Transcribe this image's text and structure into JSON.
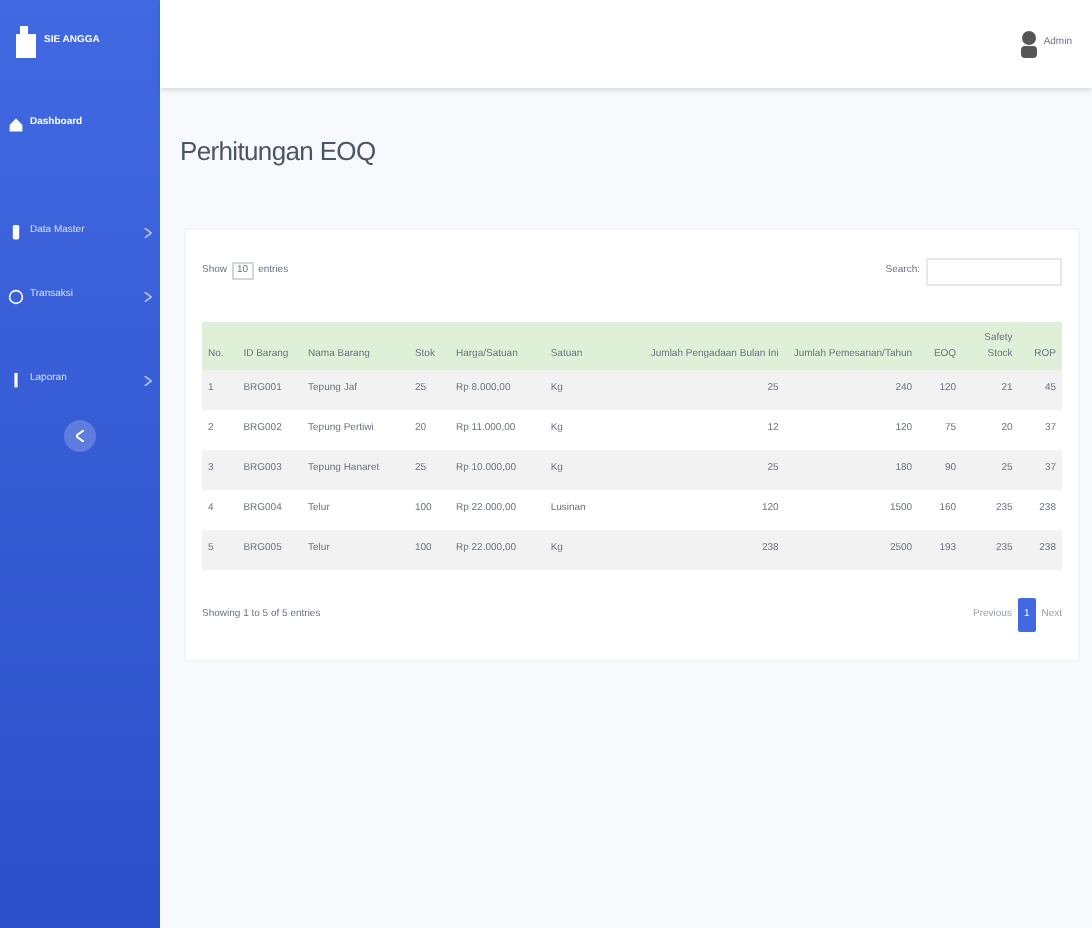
{
  "brand": "SIE ANGGA",
  "sidebar": {
    "items": [
      {
        "label": "Dashboard",
        "selected": true,
        "expandable": false
      },
      {
        "label": "Data Master",
        "selected": false,
        "expandable": true
      },
      {
        "label": "Transaksi",
        "selected": false,
        "expandable": true
      },
      {
        "label": "Laporan",
        "selected": false,
        "expandable": true
      }
    ]
  },
  "topbar": {
    "user": "Admin"
  },
  "page_title": "Perhitungan EOQ",
  "table_controls": {
    "show": "Show",
    "entries_value": "10",
    "entries": "entries",
    "search_label": "Search:"
  },
  "table": {
    "columns": [
      "No.",
      "ID Barang",
      "Nama Barang",
      "Stok",
      "Harga/Satuan",
      "Satuan",
      "Jumlah Pengadaan Bulan Ini",
      "Jumlah Pemesanan/Tahun",
      "EOQ",
      "Safety Stock",
      "ROP"
    ],
    "rows": [
      [
        "1",
        "BRG001",
        "Tepung Jaf",
        "25",
        "Rp 8.000,00",
        "Kg",
        "25",
        "240",
        "120",
        "21",
        "45"
      ],
      [
        "2",
        "BRG002",
        "Tepung Pertiwi",
        "20",
        "Rp 11.000,00",
        "Kg",
        "12",
        "120",
        "75",
        "20",
        "37"
      ],
      [
        "3",
        "BRG003",
        "Tepung Hanaret",
        "25",
        "Rp 10.000,00",
        "Kg",
        "25",
        "180",
        "90",
        "25",
        "37"
      ],
      [
        "4",
        "BRG004",
        "Telur",
        "100",
        "Rp 22.000,00",
        "Lusinan",
        "120",
        "1500",
        "160",
        "235",
        "238"
      ],
      [
        "5",
        "BRG005",
        "Telur",
        "100",
        "Rp 22.000,00",
        "Kg",
        "238",
        "2500",
        "193",
        "235",
        "238"
      ]
    ]
  },
  "footer": {
    "info": "Showing 1 to 5 of 5 entries",
    "pages": [
      {
        "label": "Previous",
        "selected": false
      },
      {
        "label": "1",
        "selected": true
      },
      {
        "label": "Next",
        "selected": false
      }
    ]
  }
}
